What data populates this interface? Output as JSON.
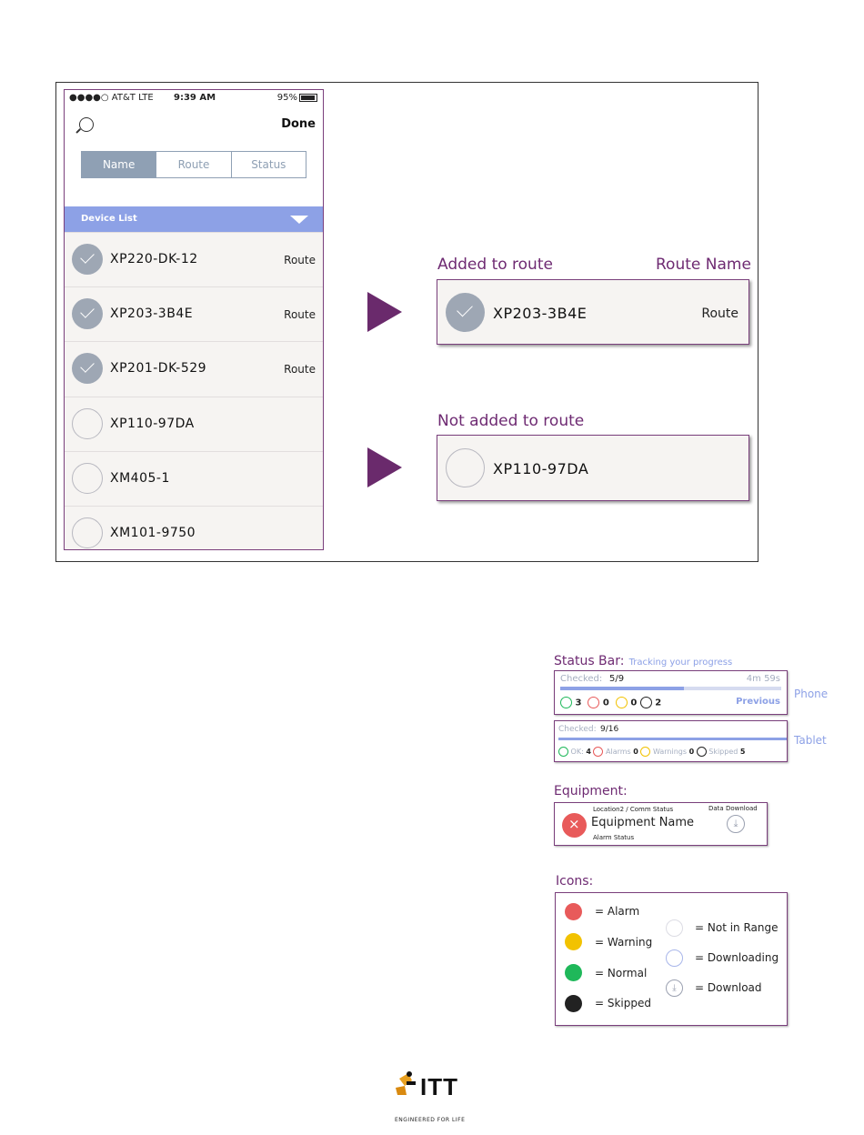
{
  "phone": {
    "status": {
      "carrier": "●●●●○ AT&T  LTE",
      "time": "9:39 AM",
      "battery": "95%"
    },
    "done_label": "Done",
    "tabs": [
      "Name",
      "Route",
      "Status"
    ],
    "list_header": "Device List",
    "rows": [
      {
        "name": "XP220-DK-12",
        "route": "Route",
        "checked": true
      },
      {
        "name": "XP203-3B4E",
        "route": "Route",
        "checked": true
      },
      {
        "name": "XP201-DK-529",
        "route": "Route",
        "checked": true
      },
      {
        "name": "XP110-97DA",
        "route": "",
        "checked": false
      },
      {
        "name": "XM405-1",
        "route": "",
        "checked": false
      },
      {
        "name": "XM101-9750",
        "route": "",
        "checked": false
      }
    ]
  },
  "callouts": {
    "added": {
      "caption": "Added to route",
      "caption_right": "Route Name",
      "name": "XP203-3B4E",
      "route": "Route"
    },
    "not_added": {
      "caption": "Not added to route",
      "name": "XP110-97DA"
    }
  },
  "status_section": {
    "title": "Status Bar:",
    "subtitle": "Tracking your progress",
    "phone": {
      "checked_label": "Checked:",
      "checked_value": "5/9",
      "progress": 0.56,
      "time": "4m 59s",
      "ok": "3",
      "alarms": "0",
      "warnings": "0",
      "skipped": "2",
      "previous": "Previous",
      "label": "Phone"
    },
    "tablet": {
      "checked_label": "Checked:",
      "checked_value": "9/16",
      "progress": 1.0,
      "ok_label": "OK:",
      "ok": "4",
      "alarms_label": "Alarms",
      "alarms": "0",
      "warnings_label": "Warnings",
      "warnings": "0",
      "skipped_label": "Skipped",
      "skipped": "5",
      "label": "Tablet"
    }
  },
  "equipment_section": {
    "title": "Equipment:",
    "location": "Location2 / Comm Status",
    "name": "Equipment Name",
    "alarm_status": "Alarm Status",
    "data_download": "Data Download"
  },
  "icons_section": {
    "title": "Icons:",
    "items": [
      {
        "label": "= Alarm",
        "icon": "alarm-icon"
      },
      {
        "label": "= Warning",
        "icon": "warning-icon"
      },
      {
        "label": "= Normal",
        "icon": "normal-icon"
      },
      {
        "label": "= Skipped",
        "icon": "skipped-icon"
      },
      {
        "label": "= Not in Range",
        "icon": "not-in-range-icon"
      },
      {
        "label": "= Downloading",
        "icon": "downloading-icon"
      },
      {
        "label": "= Download",
        "icon": "download-icon"
      }
    ],
    "colors": {
      "alarm": "#e85a5a",
      "warning": "#f2c200",
      "normal": "#1fb85a",
      "skipped": "#222222",
      "accent": "#8da1e6",
      "brand": "#6e2a72"
    }
  },
  "logo": {
    "name": "ITT",
    "tagline": "ENGINEERED FOR LIFE"
  }
}
